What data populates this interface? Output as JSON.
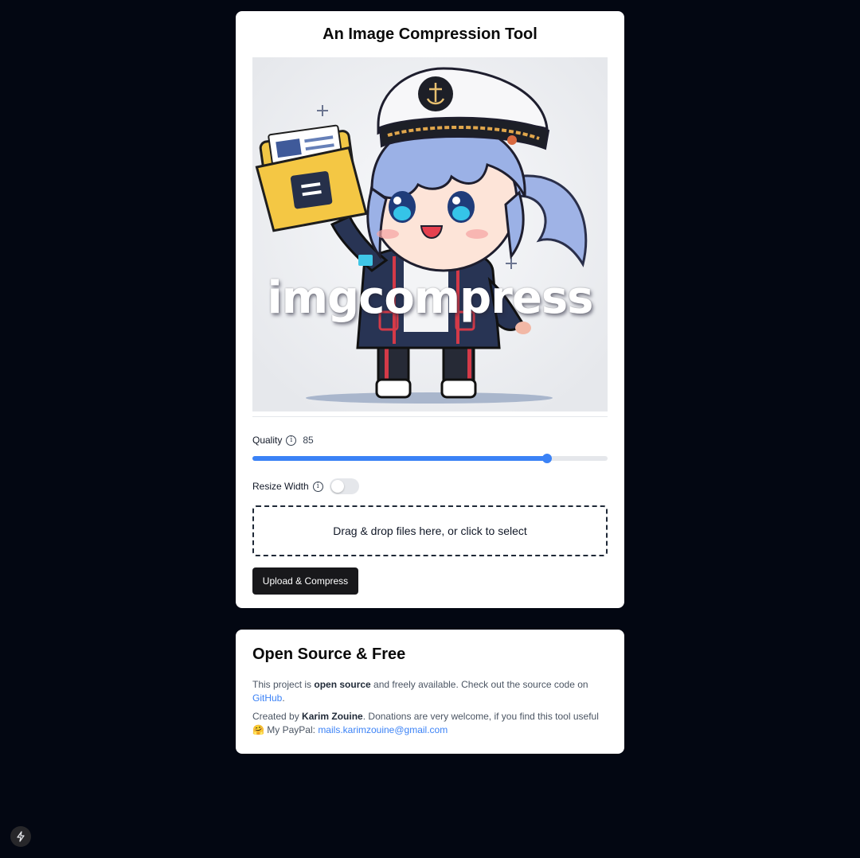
{
  "main": {
    "title": "An Image Compression Tool",
    "hero_text": "imgcompress",
    "quality": {
      "label": "Quality",
      "value": "85",
      "fraction": 0.85,
      "info_icon": "info-icon"
    },
    "resize": {
      "label": "Resize Width",
      "enabled": false,
      "info_icon": "info-icon"
    },
    "dropzone_text": "Drag & drop files here, or click to select",
    "upload_button": "Upload & Compress"
  },
  "about": {
    "title": "Open Source & Free",
    "p1_pre": "This project is ",
    "p1_bold": "open source",
    "p1_mid": " and freely available. Check out the source code on ",
    "p1_link": "GitHub",
    "p1_end": ".",
    "p2_pre": "Created by ",
    "p2_bold": "Karim Zouine",
    "p2_mid": ". Donations are very welcome, if you find this tool useful",
    "p2_emoji": "🤗",
    "p2_paypal": " My PayPal: ",
    "p2_link": "mails.karimzouine@gmail.com"
  },
  "colors": {
    "background": "#030712",
    "accent": "#3b82f6",
    "button": "#18181b"
  },
  "corner_icon": "bolt-icon"
}
